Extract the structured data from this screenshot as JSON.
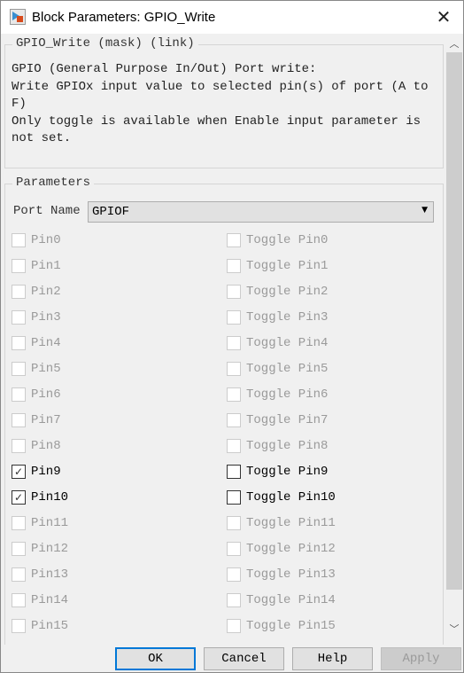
{
  "window": {
    "title": "Block Parameters: GPIO_Write",
    "close_icon": "close-icon"
  },
  "mask": {
    "legend": "GPIO_Write (mask) (link)",
    "description": "GPIO (General Purpose In/Out) Port write:\nWrite GPIOx input value to selected pin(s) of port (A to\nF)\nOnly toggle is available when Enable input parameter is\nnot set."
  },
  "parameters": {
    "legend": "Parameters",
    "port_name_label": "Port Name",
    "port_name_value": "GPIOF",
    "pins": [
      {
        "label": "Pin0",
        "checked": false,
        "enabled": false,
        "toggle_label": "Toggle Pin0",
        "toggle_checked": false,
        "toggle_enabled": false
      },
      {
        "label": "Pin1",
        "checked": false,
        "enabled": false,
        "toggle_label": "Toggle Pin1",
        "toggle_checked": false,
        "toggle_enabled": false
      },
      {
        "label": "Pin2",
        "checked": false,
        "enabled": false,
        "toggle_label": "Toggle Pin2",
        "toggle_checked": false,
        "toggle_enabled": false
      },
      {
        "label": "Pin3",
        "checked": false,
        "enabled": false,
        "toggle_label": "Toggle Pin3",
        "toggle_checked": false,
        "toggle_enabled": false
      },
      {
        "label": "Pin4",
        "checked": false,
        "enabled": false,
        "toggle_label": "Toggle Pin4",
        "toggle_checked": false,
        "toggle_enabled": false
      },
      {
        "label": "Pin5",
        "checked": false,
        "enabled": false,
        "toggle_label": "Toggle Pin5",
        "toggle_checked": false,
        "toggle_enabled": false
      },
      {
        "label": "Pin6",
        "checked": false,
        "enabled": false,
        "toggle_label": "Toggle Pin6",
        "toggle_checked": false,
        "toggle_enabled": false
      },
      {
        "label": "Pin7",
        "checked": false,
        "enabled": false,
        "toggle_label": "Toggle Pin7",
        "toggle_checked": false,
        "toggle_enabled": false
      },
      {
        "label": "Pin8",
        "checked": false,
        "enabled": false,
        "toggle_label": "Toggle Pin8",
        "toggle_checked": false,
        "toggle_enabled": false
      },
      {
        "label": "Pin9",
        "checked": true,
        "enabled": true,
        "toggle_label": "Toggle Pin9",
        "toggle_checked": false,
        "toggle_enabled": true
      },
      {
        "label": "Pin10",
        "checked": true,
        "enabled": true,
        "toggle_label": "Toggle Pin10",
        "toggle_checked": false,
        "toggle_enabled": true
      },
      {
        "label": "Pin11",
        "checked": false,
        "enabled": false,
        "toggle_label": "Toggle Pin11",
        "toggle_checked": false,
        "toggle_enabled": false
      },
      {
        "label": "Pin12",
        "checked": false,
        "enabled": false,
        "toggle_label": "Toggle Pin12",
        "toggle_checked": false,
        "toggle_enabled": false
      },
      {
        "label": "Pin13",
        "checked": false,
        "enabled": false,
        "toggle_label": "Toggle Pin13",
        "toggle_checked": false,
        "toggle_enabled": false
      },
      {
        "label": "Pin14",
        "checked": false,
        "enabled": false,
        "toggle_label": "Toggle Pin14",
        "toggle_checked": false,
        "toggle_enabled": false
      },
      {
        "label": "Pin15",
        "checked": false,
        "enabled": false,
        "toggle_label": "Toggle Pin15",
        "toggle_checked": false,
        "toggle_enabled": false
      }
    ]
  },
  "buttons": {
    "ok": "OK",
    "cancel": "Cancel",
    "help": "Help",
    "apply": "Apply"
  },
  "colors": {
    "default_button_border": "#0078d7",
    "disabled_text": "#9a9a9a"
  }
}
